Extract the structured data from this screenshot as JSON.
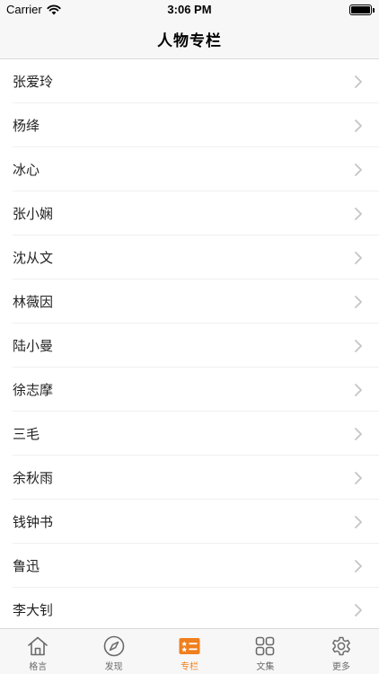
{
  "status": {
    "carrier": "Carrier",
    "time": "3:06 PM"
  },
  "nav": {
    "title": "人物专栏"
  },
  "list": [
    {
      "label": "张爱玲"
    },
    {
      "label": "杨绛"
    },
    {
      "label": "冰心"
    },
    {
      "label": "张小娴"
    },
    {
      "label": "沈从文"
    },
    {
      "label": "林薇因"
    },
    {
      "label": "陆小曼"
    },
    {
      "label": "徐志摩"
    },
    {
      "label": "三毛"
    },
    {
      "label": "余秋雨"
    },
    {
      "label": "钱钟书"
    },
    {
      "label": "鲁迅"
    },
    {
      "label": "李大钊"
    }
  ],
  "tabs": [
    {
      "label": "格言",
      "icon": "home-icon",
      "active": false
    },
    {
      "label": "发现",
      "icon": "compass-icon",
      "active": false
    },
    {
      "label": "专栏",
      "icon": "column-list-icon",
      "active": true
    },
    {
      "label": "文集",
      "icon": "grid-icon",
      "active": false
    },
    {
      "label": "更多",
      "icon": "gear-icon",
      "active": false
    }
  ],
  "colors": {
    "accent": "#f07f1d",
    "inactive": "#6b6b6b",
    "chevron": "#c4c4c6"
  }
}
